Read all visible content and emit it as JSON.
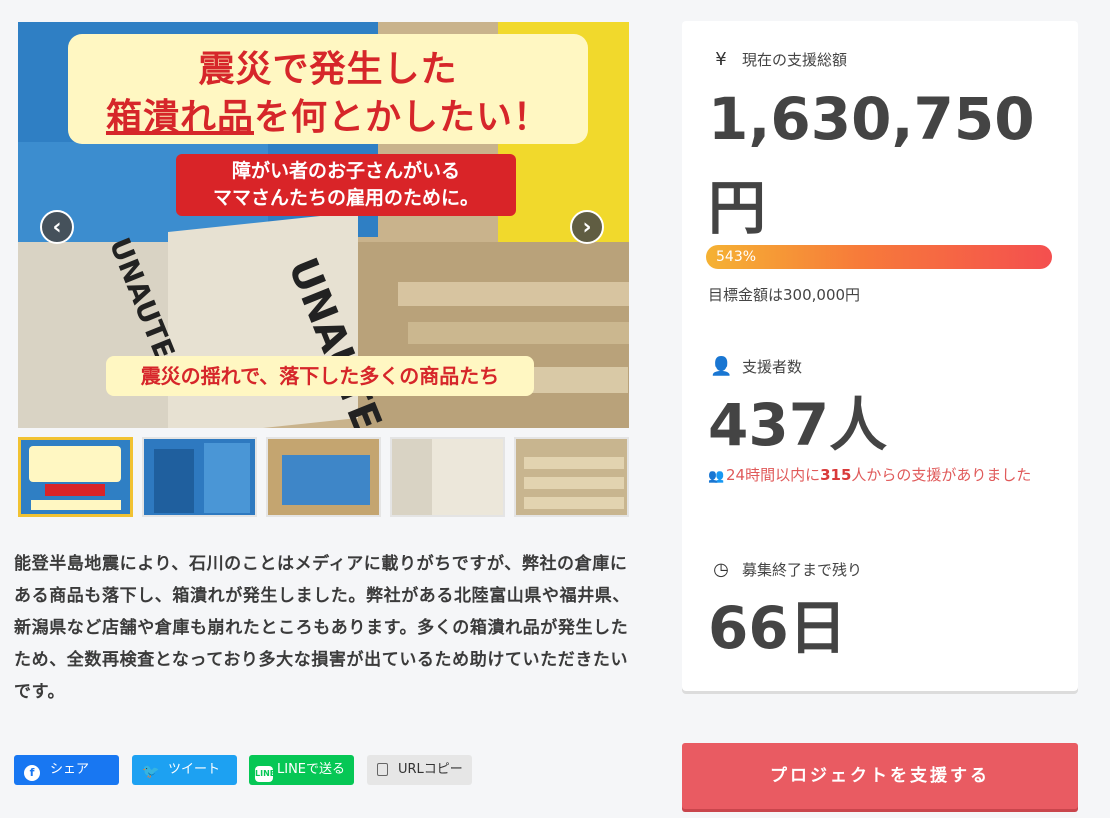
{
  "hero": {
    "title_line1": "震災で発生した",
    "title_line2_underlined": "箱潰れ品",
    "title_line2_rest": "を何とかしたい！",
    "sub_line1": "障がい者のお子さんがいる",
    "sub_line2": "ママさんたちの雇用のために。",
    "caption": "震災の揺れで、落下した多くの商品たち",
    "box_brand": "UNAUTE",
    "prev_arrow": "‹",
    "next_arrow": "›"
  },
  "thumbnails": {
    "count": 5,
    "active_index": 0
  },
  "description": "能登半島地震により、石川のことはメディアに載りがちですが、弊社の倉庫にある商品も落下し、箱潰れが発生しました。弊社がある北陸富山県や福井県、新潟県など店舗や倉庫も崩れたところもあります。多くの箱潰れ品が発生したため、全数再検査となっており多大な損害が出ているため助けていただきたいです。",
  "share": {
    "facebook": "シェア",
    "twitter": "ツイート",
    "line": "LINEで送る",
    "url_copy": "URLコピー"
  },
  "stats": {
    "total": {
      "icon": "yen-icon",
      "label": "現在の支援総額",
      "amount_line1": "1,630,750",
      "amount_line2": "円",
      "percent": "543%",
      "progress_fraction": 1.0,
      "goal_text": "目標金額は300,000円"
    },
    "supporters": {
      "icon": "user-icon",
      "label": "支援者数",
      "value": "437人",
      "recent_prefix": "24時間以内に",
      "recent_count": "315",
      "recent_suffix": "人からの支援がありました"
    },
    "remaining": {
      "icon": "clock-icon",
      "label": "募集終了まで残り",
      "value": "66日"
    }
  },
  "cta": {
    "label": "プロジェクトを支援する"
  },
  "colors": {
    "accent": "#e95b62",
    "alert": "#e05a5a",
    "facebook": "#1877f2",
    "twitter": "#1da1f2",
    "line": "#06c755"
  }
}
